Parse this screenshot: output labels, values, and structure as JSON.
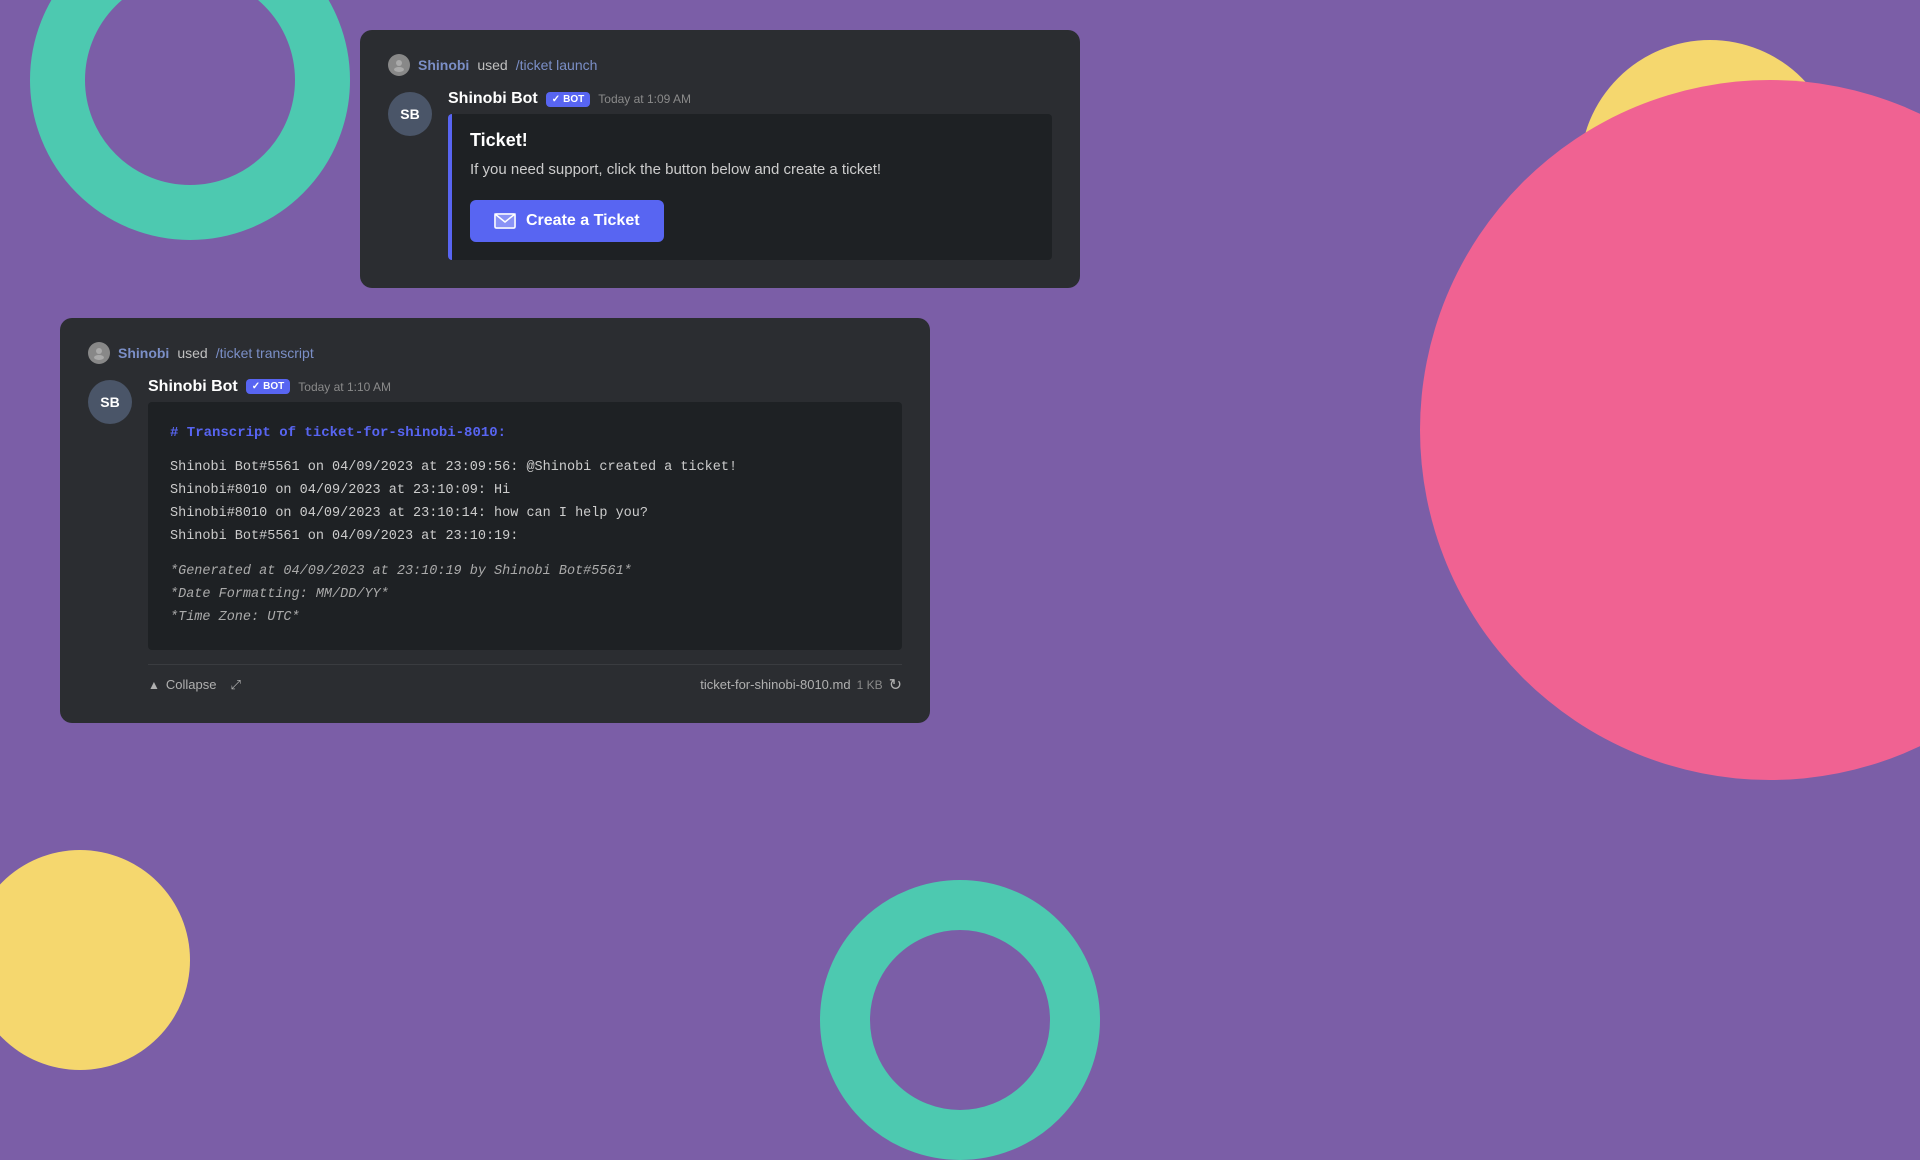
{
  "background": {
    "color": "#7B5EA7"
  },
  "card1": {
    "command_user": "Shinobi",
    "command_used_text": "used",
    "command": "/ticket launch",
    "bot_name": "Shinobi Bot",
    "bot_badge": "BOT",
    "timestamp": "Today at 1:09 AM",
    "avatar_initials": "SB",
    "embed_title": "Ticket!",
    "embed_description": "If you need support, click the button below and create a ticket!",
    "button_label": "Create a Ticket",
    "button_icon": "✉"
  },
  "card2": {
    "command_user": "Shinobi",
    "command_used_text": "used",
    "command": "/ticket transcript",
    "bot_name": "Shinobi Bot",
    "bot_badge": "BOT",
    "timestamp": "Today at 1:10 AM",
    "avatar_initials": "SB",
    "transcript_title": "# Transcript of ticket-for-shinobi-8010:",
    "transcript_lines": [
      "Shinobi Bot#5561 on 04/09/2023 at 23:09:56: @Shinobi created a ticket!",
      "Shinobi#8010 on 04/09/2023 at 23:10:09: Hi",
      "Shinobi#8010 on 04/09/2023 at 23:10:14: how can I help you?",
      "Shinobi Bot#5561 on 04/09/2023 at 23:10:19:"
    ],
    "generated_lines": [
      "*Generated at 04/09/2023 at 23:10:19 by Shinobi Bot#5561*",
      "*Date Formatting: MM/DD/YY*",
      "*Time Zone: UTC*"
    ],
    "collapse_label": "Collapse",
    "file_name": "ticket-for-shinobi-8010.md",
    "file_size": "1 KB"
  },
  "colors": {
    "purple_bg": "#7B5EA7",
    "teal": "#4DC9B0",
    "pink": "#F06292",
    "yellow": "#F5D76E",
    "discord_blurple": "#5865F2",
    "card_bg": "#2B2D31",
    "embed_bg": "#1E2124"
  }
}
